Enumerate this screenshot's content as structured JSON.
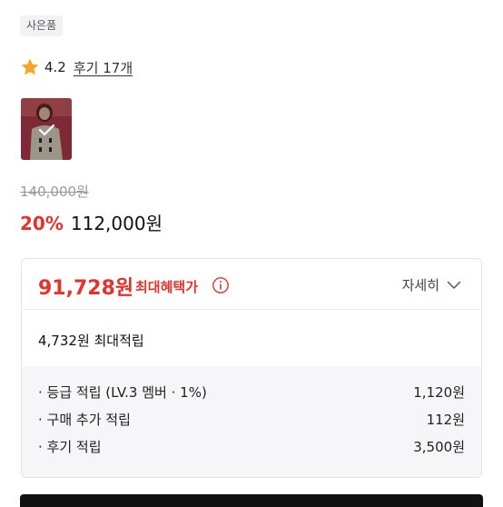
{
  "product": {
    "title_fragment": "",
    "tag": "사은품",
    "rating": "4.2",
    "reviews_link": "후기 17개",
    "original_price": "140,000원",
    "discount_rate": "20%",
    "sale_price": "112,000원"
  },
  "benefits": {
    "max_benefit_price": "91,728원",
    "max_benefit_label": "최대혜택가",
    "detail_label": "자세히",
    "max_points": "4,732원 최대적립",
    "items": [
      {
        "label": "· 등급 적립 (LV.3 멤버 · 1%)",
        "value": "1,120원"
      },
      {
        "label": "· 구매 추가 적립",
        "value": "112원"
      },
      {
        "label": "· 후기 적립",
        "value": "3,500원"
      }
    ]
  },
  "colors": {
    "accent_red": "#e5322c",
    "star": "#f5a623",
    "tag_bg": "#f2f2f4",
    "list_bg": "#f6f6f8"
  },
  "icons": [
    "star-icon",
    "info-icon",
    "chevron-down-icon",
    "check-icon"
  ]
}
